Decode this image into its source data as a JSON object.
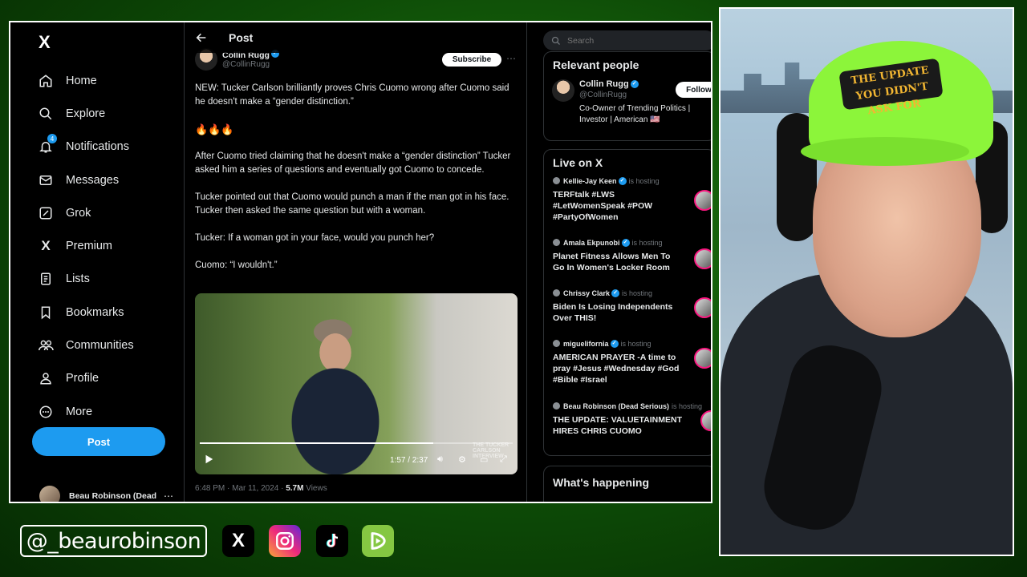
{
  "sidebar": {
    "logo": "X",
    "items": [
      {
        "label": "Home",
        "icon": "home-icon"
      },
      {
        "label": "Explore",
        "icon": "search-icon"
      },
      {
        "label": "Notifications",
        "icon": "bell-icon",
        "badge": "4"
      },
      {
        "label": "Messages",
        "icon": "envelope-icon"
      },
      {
        "label": "Grok",
        "icon": "grok-icon"
      },
      {
        "label": "Premium",
        "icon": "x-icon"
      },
      {
        "label": "Lists",
        "icon": "list-icon"
      },
      {
        "label": "Bookmarks",
        "icon": "bookmark-icon"
      },
      {
        "label": "Communities",
        "icon": "people-icon"
      },
      {
        "label": "Profile",
        "icon": "person-icon"
      },
      {
        "label": "More",
        "icon": "more-circle-icon"
      }
    ],
    "post_button": "Post",
    "account_name": "Beau Robinson (Dead Serious)",
    "account_more": "⋯"
  },
  "main": {
    "title": "Post",
    "author_name": "Collin Rugg",
    "author_handle": "@CollinRugg",
    "subscribe": "Subscribe",
    "more": "⋯",
    "paragraphs": [
      "NEW: Tucker Carlson brilliantly proves Chris Cuomo wrong after Cuomo said he doesn't make a “gender distinction.”",
      "🔥🔥🔥",
      "After Cuomo tried claiming that he doesn't make a “gender distinction” Tucker asked him a series of questions and eventually got Cuomo to concede.",
      "Tucker pointed out that Cuomo would punch a man if the man got in his face. Tucker then asked the same question but with a woman.",
      "Tucker: If a woman got in your face, would you punch her?",
      "Cuomo: “I wouldn't.”"
    ],
    "video": {
      "time": "1:57 / 2:37",
      "progress": 0.746,
      "watermark": "THE TUCKER CARLSON INTERVIEW"
    },
    "meta_time": "6:48 PM · Mar 11, 2024 · ",
    "meta_views": "5.7M",
    "meta_views_label": " Views"
  },
  "right": {
    "search_placeholder": "Search",
    "relevant_title": "Relevant people",
    "person": {
      "name": "Collin Rugg",
      "handle": "@CollinRugg",
      "bio": "Co-Owner of Trending Politics | Investor | American 🇺🇸",
      "follow": "Follow"
    },
    "live_title": "Live on X",
    "hosting_label": "is hosting",
    "live": [
      {
        "host": "Kellie-Jay Keen",
        "title": "TERFtalk  #LWS #LetWomenSpeak  #POW #PartyOfWomen"
      },
      {
        "host": "Amala Ekpunobi",
        "title": "Planet Fitness Allows Men To Go In Women's Locker Room"
      },
      {
        "host": "Chrissy Clark",
        "title": "Biden Is Losing Independents Over THIS!"
      },
      {
        "host": "miguelifornia",
        "title": "AMERICAN PRAYER -A time to pray #Jesus #Wednesday #God #Bible #Israel"
      },
      {
        "host": "Beau Robinson (Dead Serious)",
        "title": "THE UPDATE: VALUETAINMENT HIRES CHRIS CUOMO"
      }
    ],
    "happening_title": "What's happening"
  },
  "webcam": {
    "hat_patch": "THE UPDATE YOU DIDN'T ASK FOR"
  },
  "social": {
    "handle": "@_beaurobinson",
    "icons": [
      "x-icon",
      "instagram-icon",
      "tiktok-icon",
      "rumble-icon"
    ],
    "x_glyph": "X"
  },
  "colors": {
    "accent": "#1d9bf0",
    "background": "#000000",
    "live_ring": "#f91880",
    "hat_green": "#8cf53a"
  }
}
